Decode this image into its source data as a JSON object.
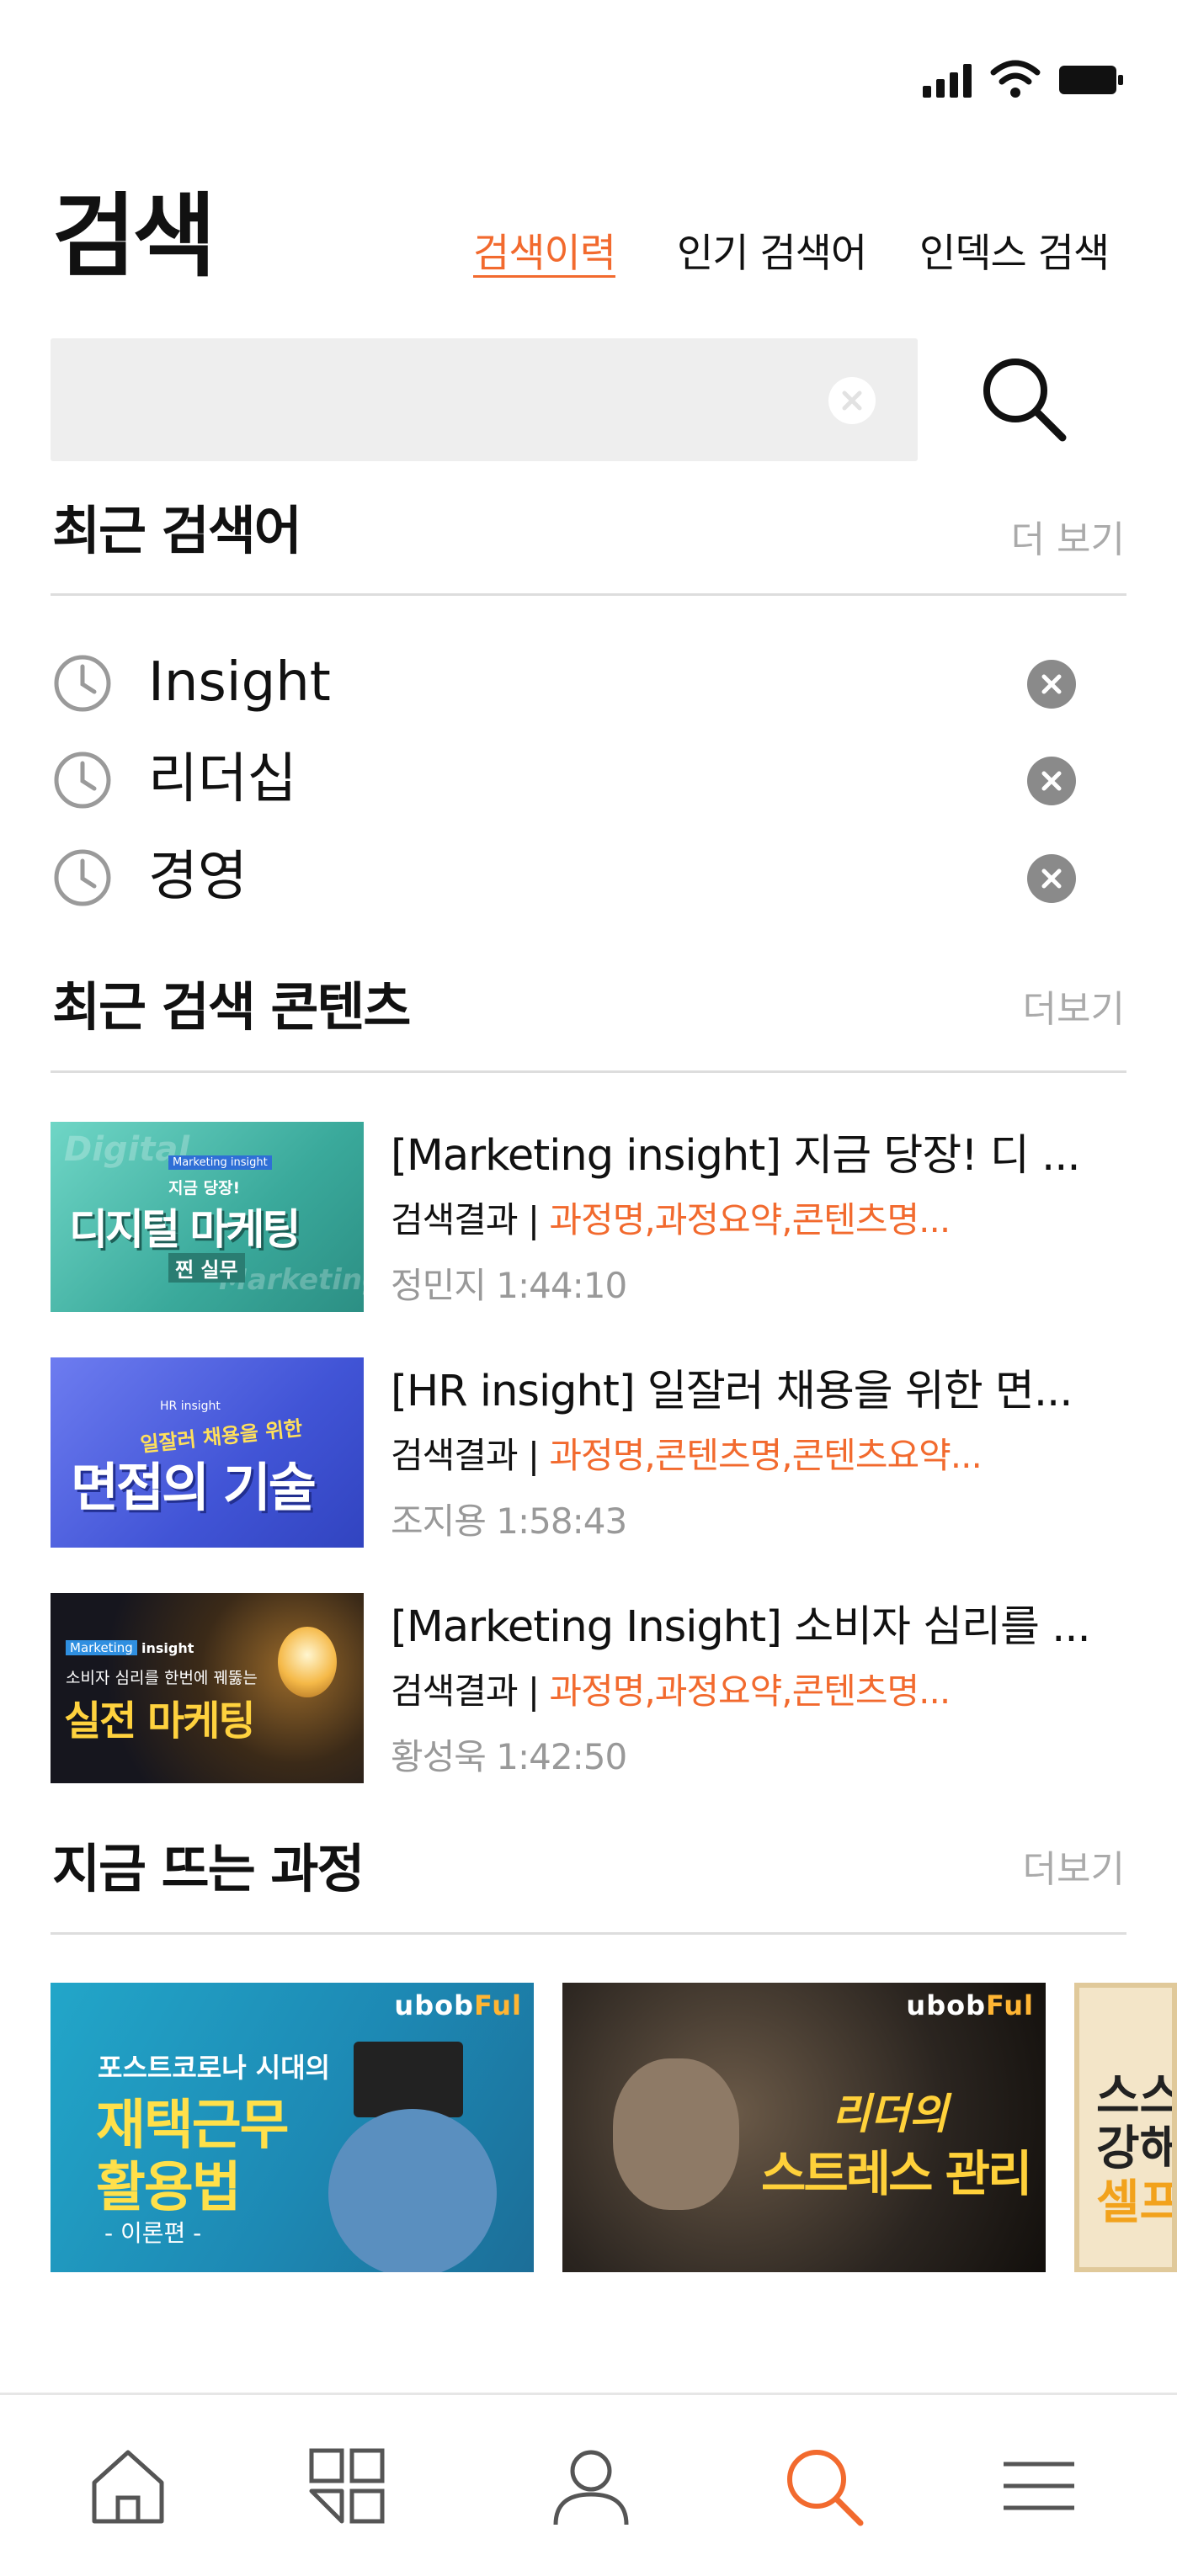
{
  "header": {
    "title": "검색",
    "tabs": [
      {
        "label": "검색이력",
        "active": true
      },
      {
        "label": "인기 검색어",
        "active": false
      },
      {
        "label": "인덱스 검색",
        "active": false
      }
    ]
  },
  "search": {
    "value": "",
    "placeholder": ""
  },
  "recent_keywords": {
    "title": "최근 검색어",
    "more": "더 보기",
    "items": [
      "Insight",
      "리더십",
      "경영"
    ]
  },
  "recent_contents": {
    "title": "최근 검색 콘텐츠",
    "more": "더보기",
    "items": [
      {
        "title": "[Marketing insight] 지금 당장! 디 ...",
        "tag_prefix": "검색결과 | ",
        "tags": "과정명,과정요약,콘텐츠명...",
        "meta": "정민지 1:44:10",
        "thumb_text": {
          "badge": "Marketing insight",
          "sub": "지금 당장!",
          "main": "디지털 마케팅",
          "tail": "찐 실무",
          "bg1": "Digital",
          "bg2": "Marketing"
        }
      },
      {
        "title": "[HR insight] 일잘러 채용을 위한 면...",
        "tag_prefix": "검색결과 | ",
        "tags": "과정명,콘텐츠명,콘텐츠요약...",
        "meta": "조지용 1:58:43",
        "thumb_text": {
          "badge": "HR insight",
          "sub": "일잘러 채용을 위한",
          "main": "면접의 기술"
        }
      },
      {
        "title": "[Marketing Insight] 소비자 심리를 ...",
        "tag_prefix": "검색결과 | ",
        "tags": "과정명,과정요약,콘텐츠명...",
        "meta": "황성욱 1:42:50",
        "thumb_text": {
          "badge": "Marketing",
          "badge2": "insight",
          "sub": "소비자 심리를 한번에 꿰뚫는",
          "main": "실전 마케팅"
        }
      }
    ]
  },
  "trending": {
    "title": "지금 뜨는 과정",
    "more": "더보기",
    "brand_a": "ubob",
    "brand_b": "Ful",
    "cards": [
      {
        "line1": "포스트코로나 시대의",
        "line2": "재택근무",
        "line3": "활용법",
        "line4": "- 이론편 -"
      },
      {
        "line1": "리더의",
        "line2": "스트레스 관리"
      },
      {
        "line1": "스스",
        "line2": "강해",
        "line3": "셀프"
      }
    ]
  },
  "colors": {
    "accent": "#f26a2e",
    "muted": "#aaaaaa",
    "search_bg": "#eeeeee"
  },
  "nav": {
    "items": [
      "home-icon",
      "grid-icon",
      "user-icon",
      "search-icon",
      "menu-icon"
    ],
    "active": "search-icon"
  }
}
